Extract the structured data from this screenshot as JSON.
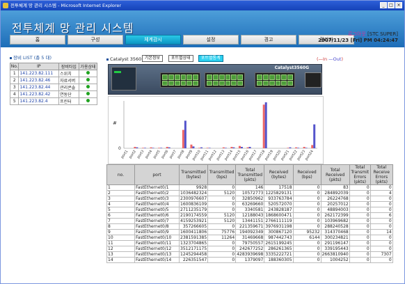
{
  "window": {
    "title": "전투체계 망 관리 시스템 - Microsoft Internet Explorer"
  },
  "app_title": "전투체계 망 관리 시스템",
  "nav": [
    {
      "label": "홈",
      "active": false
    },
    {
      "label": "구성",
      "active": false
    },
    {
      "label": "체계감시",
      "active": true
    },
    {
      "label": "설정",
      "active": false
    },
    {
      "label": "경고",
      "active": false
    },
    {
      "label": "관리자",
      "active": false
    }
  ],
  "user": {
    "logout": "로그아웃",
    "name": "[STC SUPER]",
    "datetime": "2007/11/23 [Fri] PM 04:24:47"
  },
  "device_list": {
    "title": "장비 LIST (총 5 대)",
    "headers": [
      "No.",
      "IP",
      "장비타입",
      "가용상태"
    ],
    "rows": [
      {
        "no": "1",
        "ip": "141.223.82.111",
        "type": "스위치"
      },
      {
        "no": "2",
        "ip": "141.223.82.46",
        "type": "자료서버"
      },
      {
        "no": "3",
        "ip": "141.223.82.44",
        "type": "관리콘솔"
      },
      {
        "no": "4",
        "ip": "141.223.82.42",
        "type": "연동단"
      },
      {
        "no": "5",
        "ip": "141.223.82.4",
        "type": "프린터"
      }
    ],
    "status_color": "#1fa21f"
  },
  "switch": {
    "name": "Catalyst 3560",
    "tabs": [
      "기본정보",
      "포트별상태",
      "포트별통계"
    ],
    "active_tab": 2,
    "model": "Catalyst3560G"
  },
  "legend": {
    "in": "In",
    "out": "Out"
  },
  "chart_data": {
    "type": "bar",
    "categories": [
      "port1",
      "port2",
      "port3",
      "port4",
      "port5",
      "port6",
      "port7",
      "port8",
      "port9",
      "port10",
      "port11",
      "port12",
      "port13",
      "port14",
      "port15",
      "port16",
      "port17",
      "port18",
      "port19",
      "port20",
      "port21",
      "port22",
      "port23",
      "port24"
    ],
    "series": [
      {
        "name": "In",
        "values": [
          0,
          3,
          1,
          2,
          1,
          3,
          0,
          40,
          8,
          1,
          1,
          0,
          2,
          3,
          5,
          2,
          0,
          95,
          0,
          0,
          1,
          2,
          3,
          7
        ]
      },
      {
        "name": "Out",
        "values": [
          0,
          2,
          1,
          1,
          1,
          2,
          0,
          60,
          4,
          2,
          1,
          0,
          1,
          2,
          3,
          3,
          0,
          100,
          0,
          0,
          2,
          1,
          1,
          52
        ]
      }
    ],
    "ylabel": "#",
    "yticks": [
      "0"
    ],
    "colors": [
      "#e66",
      "#55c"
    ]
  },
  "grid": {
    "headers": [
      "no.",
      "port",
      "Transmitted (bytes)",
      "Transmitted (bps)",
      "Total Transmitted (pkts)",
      "Received (bytes)",
      "Received (bps)",
      "Total Received (pkts)",
      "Total Transmit Errors (pkts)",
      "Total Receive Errors (pkts)"
    ],
    "rows": [
      [
        "1",
        "FastEthernet0/1",
        "9928",
        "0",
        "146",
        "17518",
        "0",
        "83",
        "0",
        "0"
      ],
      [
        "2",
        "FastEthernet0/2",
        "1036482324",
        "5120",
        "10572773",
        "1225829131",
        "0",
        "284892039",
        "0",
        "4"
      ],
      [
        "3",
        "FastEthernet0/3",
        "2300976607",
        "0",
        "32850962",
        "933763784",
        "0",
        "26224768",
        "0",
        "0"
      ],
      [
        "4",
        "FastEthernet0/4",
        "1600836109",
        "0",
        "63269660",
        "520572070",
        "0",
        "20257012",
        "0",
        "0"
      ],
      [
        "5",
        "FastEthernet0/5",
        "2711235179",
        "0",
        "3340581",
        "243828187",
        "0",
        "48894003",
        "0",
        "0"
      ],
      [
        "6",
        "FastEthernet0/6",
        "2190174559",
        "5120",
        "12188043",
        "1868600471",
        "0",
        "262172399",
        "0",
        "6"
      ],
      [
        "7",
        "FastEthernet0/7",
        "4159253921",
        "5120",
        "13441151",
        "2766111119",
        "0",
        "103969682",
        "0",
        "0"
      ],
      [
        "8",
        "FastEthernet0/8",
        "357266605",
        "0",
        "221359671",
        "3976931198",
        "0",
        "288240528",
        "0",
        "0"
      ],
      [
        "9",
        "FastEthernet0/9",
        "1600411806",
        "75776",
        "194092349",
        "300867120",
        "95232",
        "314370468",
        "0",
        "14"
      ],
      [
        "10",
        "FastEthernet0/10",
        "2381591385",
        "11264",
        "31469668",
        "987442743",
        "6144",
        "300234821",
        "0",
        "0"
      ],
      [
        "11",
        "FastEthernet0/11",
        "1323704865",
        "0",
        "79750557",
        "2615199245",
        "0",
        "291196147",
        "0",
        "0"
      ],
      [
        "12",
        "FastEthernet0/12",
        "3512171175",
        "0",
        "242677252",
        "286261365",
        "0",
        "339195443",
        "0",
        "0"
      ],
      [
        "13",
        "FastEthernet0/13",
        "1245294458",
        "0",
        "4283939698",
        "3335222721",
        "0",
        "2663810940",
        "0",
        "7307"
      ],
      [
        "14",
        "FastEthernet0/14",
        "226351547",
        "0",
        "1379097",
        "188360305",
        "0",
        "1004252",
        "0",
        "0"
      ]
    ]
  }
}
